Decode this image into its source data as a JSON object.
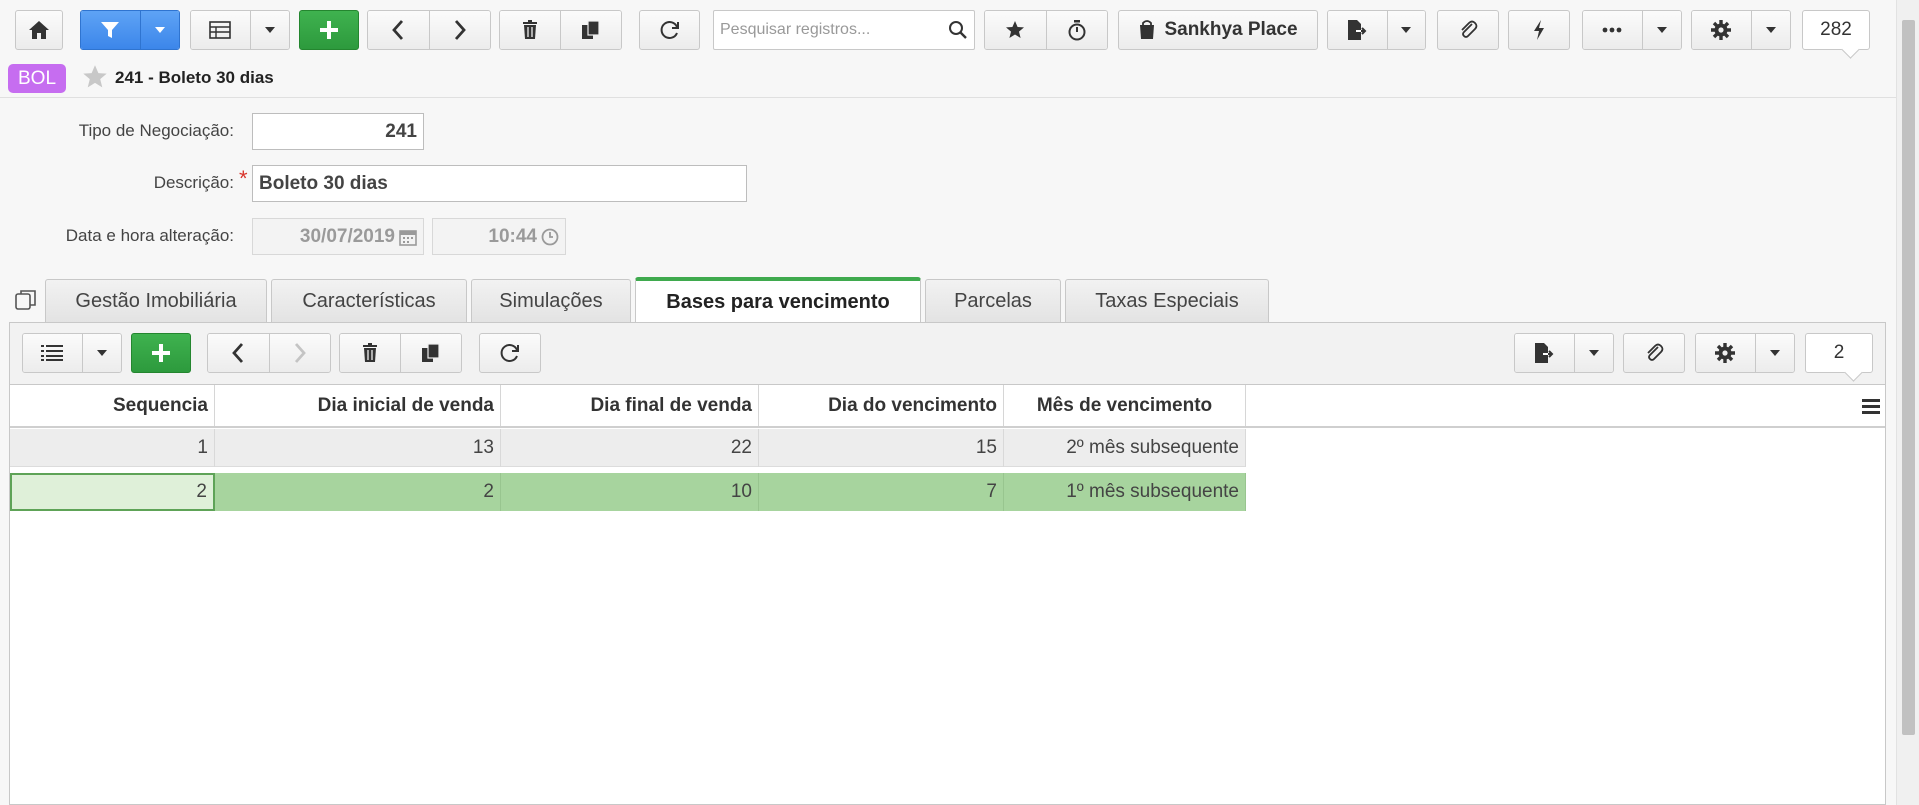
{
  "toolbar": {
    "search_placeholder": "Pesquisar registros...",
    "place_label": "Sankhya Place",
    "record_count": "282",
    "icons": [
      "home-icon",
      "filter-icon",
      "grid-icon",
      "add-icon",
      "prev-icon",
      "next-icon",
      "delete-icon",
      "copy-icon",
      "refresh-icon",
      "search-icon",
      "star-icon",
      "timer-icon",
      "bag-icon",
      "export-icon",
      "attach-icon",
      "flash-icon",
      "more-icon",
      "gear-icon"
    ]
  },
  "header": {
    "tag": "BOL",
    "title": "241 - Boleto 30 dias"
  },
  "form": {
    "tipo_label": "Tipo de Negociação:",
    "tipo_value": "241",
    "descricao_label": "Descrição:",
    "descricao_required": "*",
    "descricao_value": "Boleto 30 dias",
    "data_label": "Data e hora alteração:",
    "data_value": "30/07/2019",
    "hora_value": "10:44"
  },
  "tabs": [
    {
      "label": "Gestão Imobiliária",
      "active": false
    },
    {
      "label": "Características",
      "active": false
    },
    {
      "label": "Simulações",
      "active": false
    },
    {
      "label": "Bases para vencimento",
      "active": true
    },
    {
      "label": "Parcelas",
      "active": false
    },
    {
      "label": "Taxas Especiais",
      "active": false
    }
  ],
  "grid": {
    "record_count": "2",
    "columns": [
      "Sequencia",
      "Dia inicial de venda",
      "Dia final de venda",
      "Dia do vencimento",
      "Mês de vencimento"
    ],
    "rows": [
      [
        "1",
        "13",
        "22",
        "15",
        "2º mês subsequente"
      ],
      [
        "2",
        "2",
        "10",
        "7",
        "1º mês subsequente"
      ]
    ],
    "selected_row": 1
  },
  "colors": {
    "accent_blue": "#3c86ea",
    "accent_green": "#2d9a3d",
    "tag_purple": "#c66df0",
    "selected_row": "#a7d49e",
    "active_tab_border": "#3faa4e"
  }
}
